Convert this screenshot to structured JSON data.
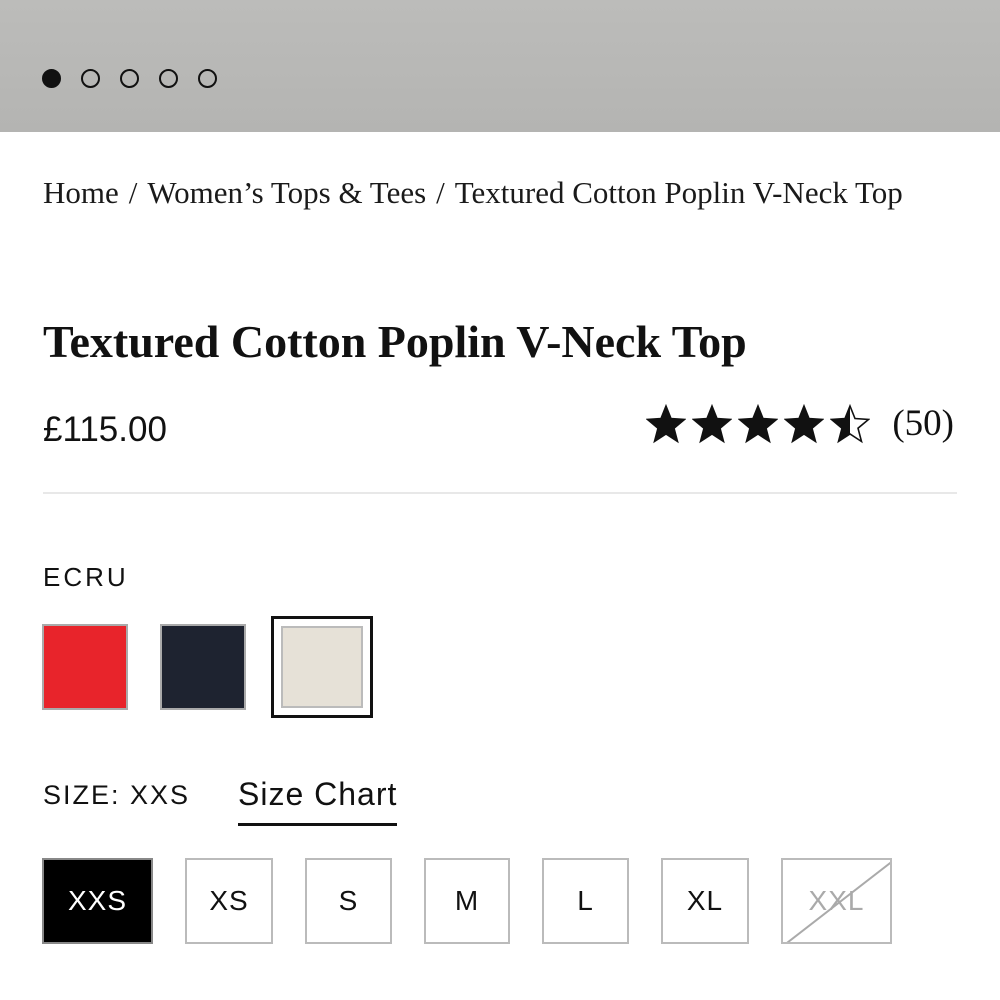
{
  "carousel": {
    "total": 5,
    "active_index": 0
  },
  "breadcrumb": {
    "items": [
      "Home",
      "Women’s Tops & Tees",
      "Textured Cotton Poplin V-Neck Top"
    ],
    "separator": "/"
  },
  "product": {
    "title": "Textured Cotton Poplin V-Neck Top",
    "price": "£115.00",
    "rating": 4.5,
    "rating_max": 5,
    "review_count": "(50)"
  },
  "color": {
    "selected_label": "ECRU",
    "swatches": [
      {
        "name": "red",
        "color": "#e8242b"
      },
      {
        "name": "navy",
        "color": "#1e2330"
      },
      {
        "name": "ecru",
        "color": "#e6e1d7",
        "selected": true
      }
    ]
  },
  "size": {
    "label": "SIZE: XXS",
    "chart_link": "Size Chart",
    "options": [
      {
        "label": "XXS",
        "selected": true
      },
      {
        "label": "XS"
      },
      {
        "label": "S"
      },
      {
        "label": "M"
      },
      {
        "label": "L"
      },
      {
        "label": "XL"
      },
      {
        "label": "XXL",
        "disabled": true
      }
    ]
  }
}
